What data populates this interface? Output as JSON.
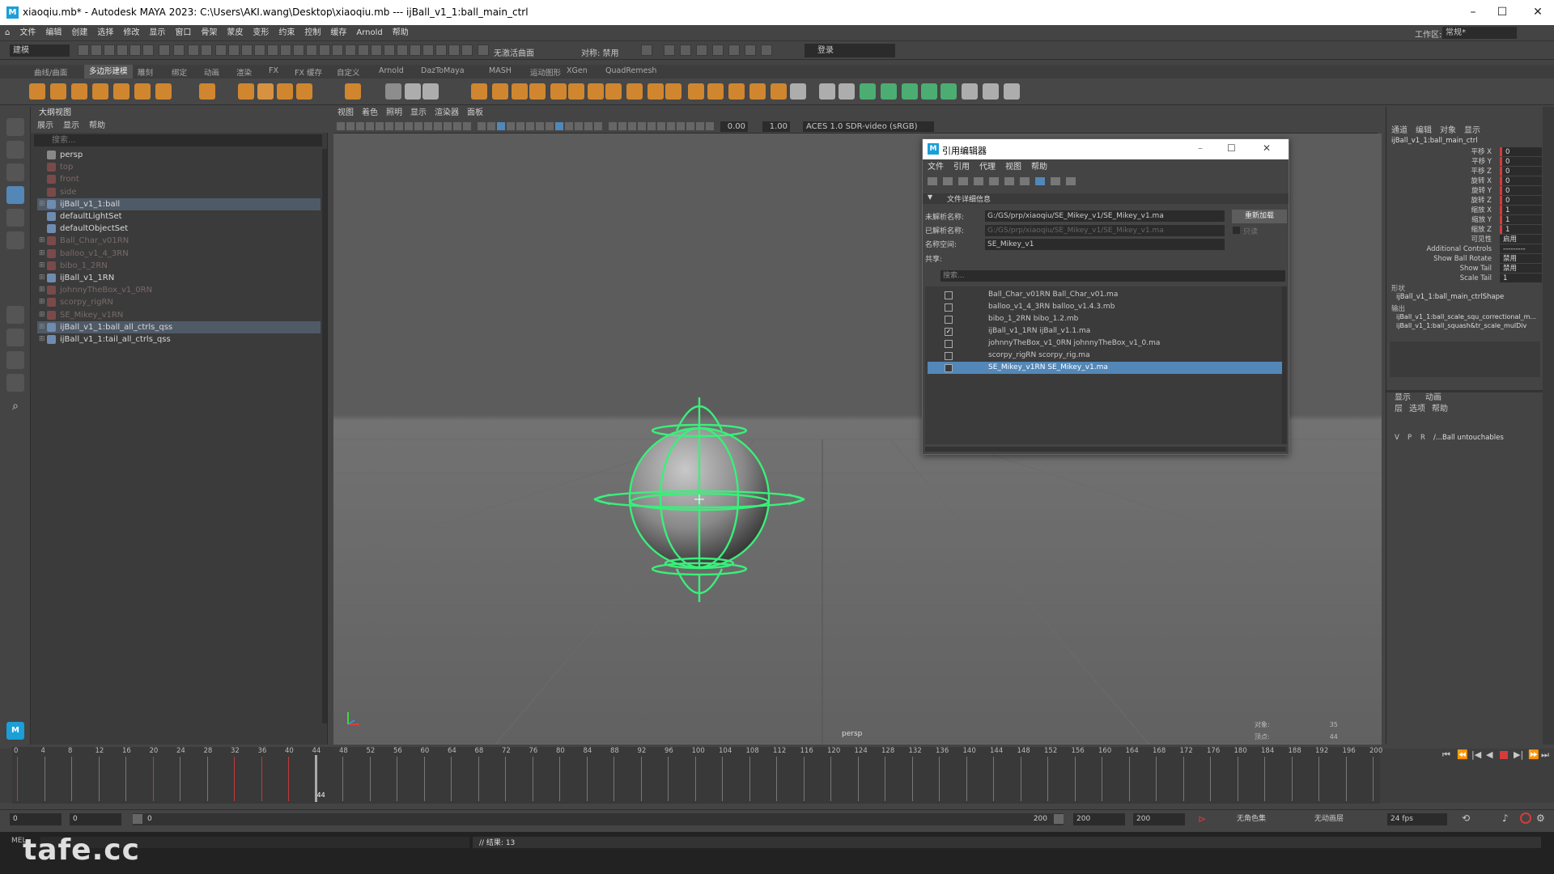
{
  "app": {
    "title": "xiaoqiu.mb* - Autodesk MAYA 2023: C:\\Users\\AKI.wang\\Desktop\\xiaoqiu.mb  ---  ijBall_v1_1:ball_main_ctrl"
  },
  "menu": [
    "文件",
    "编辑",
    "创建",
    "选择",
    "修改",
    "显示",
    "窗口",
    "骨架",
    "蒙皮",
    "变形",
    "约束",
    "控制",
    "缓存",
    "Arnold",
    "帮助"
  ],
  "workspace": {
    "label": "工作区:",
    "value": "常规*"
  },
  "status": {
    "mode": "建模",
    "live_surface": "无激活曲面",
    "symmetry": "对称: 禁用",
    "login": "登录"
  },
  "shelf_tabs": [
    "曲线/曲面",
    "多边形建模",
    "雕刻",
    "绑定",
    "动画",
    "渲染",
    "FX",
    "FX 缓存",
    "自定义",
    "Arnold",
    "DazToMaya",
    "MASH",
    "运动图形",
    "XGen",
    "QuadRemesh"
  ],
  "outliner": {
    "title": "大纲视图",
    "menu": [
      "展示",
      "显示",
      "帮助"
    ],
    "search_placeholder": "搜索...",
    "items": [
      {
        "label": "persp",
        "dim": false,
        "expand": ""
      },
      {
        "label": "top",
        "dim": true,
        "expand": ""
      },
      {
        "label": "front",
        "dim": true,
        "expand": ""
      },
      {
        "label": "side",
        "dim": true,
        "expand": ""
      },
      {
        "label": "ijBall_v1_1:ball",
        "dim": false,
        "expand": "⊞",
        "sel": true
      },
      {
        "label": "defaultLightSet",
        "dim": false,
        "expand": ""
      },
      {
        "label": "defaultObjectSet",
        "dim": false,
        "expand": ""
      },
      {
        "label": "Ball_Char_v01RN",
        "dim": true,
        "expand": "⊞"
      },
      {
        "label": "balloo_v1_4_3RN",
        "dim": true,
        "expand": "⊞"
      },
      {
        "label": "bibo_1_2RN",
        "dim": true,
        "expand": "⊞"
      },
      {
        "label": "ijBall_v1_1RN",
        "dim": false,
        "expand": "⊞"
      },
      {
        "label": "johnnyTheBox_v1_0RN",
        "dim": true,
        "expand": "⊞"
      },
      {
        "label": "scorpy_rigRN",
        "dim": true,
        "expand": "⊞"
      },
      {
        "label": "SE_Mikey_v1RN",
        "dim": true,
        "expand": "⊞"
      },
      {
        "label": "ijBall_v1_1:ball_all_ctrls_qss",
        "dim": false,
        "expand": "⊞",
        "sel": true
      },
      {
        "label": "ijBall_v1_1:tail_all_ctrls_qss",
        "dim": false,
        "expand": "⊞"
      }
    ]
  },
  "viewport": {
    "menu": [
      "视图",
      "着色",
      "照明",
      "显示",
      "渲染器",
      "面板"
    ],
    "exposure": "0.00",
    "gamma": "1.00",
    "colorspace": "ACES 1.0 SDR-video (sRGB)",
    "camera": "persp",
    "stats": [
      {
        "k": "对象:",
        "v": "35"
      },
      {
        "k": "顶点:",
        "v": "44"
      }
    ]
  },
  "ref_editor": {
    "title": "引用编辑器",
    "menu": [
      "文件",
      "引用",
      "代理",
      "视图",
      "帮助"
    ],
    "section": "文件详细信息",
    "unresolved_label": "未解析名称:",
    "unresolved_value": "G:/GS/prp/xiaoqiu/SE_Mikey_v1/SE_Mikey_v1.ma",
    "resolved_label": "已解析名称:",
    "resolved_value": "G:/GS/prp/xiaoqiu/SE_Mikey_v1/SE_Mikey_v1.ma",
    "namespace_label": "名称空间:",
    "namespace_value": "SE_Mikey_v1",
    "shared_label": "共享:",
    "reload_label": "重新加载",
    "readonly_label": "只读",
    "search_placeholder": "搜索...",
    "refs": [
      {
        "name": "Ball_Char_v01RN Ball_Char_v01.ma",
        "checked": false
      },
      {
        "name": "balloo_v1_4_3RN balloo_v1.4.3.mb",
        "checked": false
      },
      {
        "name": "bibo_1_2RN bibo_1.2.mb",
        "checked": false
      },
      {
        "name": "ijBall_v1_1RN ijBall_v1.1.ma",
        "checked": true
      },
      {
        "name": "johnnyTheBox_v1_0RN johnnyTheBox_v1_0.ma",
        "checked": false
      },
      {
        "name": "scorpy_rigRN scorpy_rig.ma",
        "checked": false
      },
      {
        "name": "SE_Mikey_v1RN SE_Mikey_v1.ma",
        "checked": false,
        "sel": true
      }
    ]
  },
  "channel_box": {
    "tabs": [
      "通道",
      "编辑",
      "对象",
      "显示"
    ],
    "node": "ijBall_v1_1:ball_main_ctrl",
    "channels": [
      {
        "name": "平移 X",
        "value": "0"
      },
      {
        "name": "平移 Y",
        "value": "0"
      },
      {
        "name": "平移 Z",
        "value": "0"
      },
      {
        "name": "旋转 X",
        "value": "0"
      },
      {
        "name": "旋转 Y",
        "value": "0"
      },
      {
        "name": "旋转 Z",
        "value": "0"
      },
      {
        "name": "缩放 X",
        "value": "1"
      },
      {
        "name": "缩放 Y",
        "value": "1"
      },
      {
        "name": "缩放 Z",
        "value": "1"
      },
      {
        "name": "可见性",
        "value": "启用"
      },
      {
        "name": "Additional Controls",
        "value": "---------"
      },
      {
        "name": "Show Ball Rotate",
        "value": "禁用"
      },
      {
        "name": "Show Tail",
        "value": "禁用"
      },
      {
        "name": "Scale Tail",
        "value": "1"
      }
    ],
    "shape_header": "形状",
    "shape": "ijBall_v1_1:ball_main_ctrlShape",
    "output_header": "输出",
    "outputs": [
      "ijBall_v1_1:ball_scale_squ_correctional_m...",
      "ijBall_v1_1:ball_squash&tr_scale_mulDiv"
    ],
    "layer_tabs": [
      "显示",
      "动画"
    ],
    "layer_menu": [
      "层",
      "选项",
      "帮助"
    ],
    "layer": {
      "v": "V",
      "p": "P",
      "r": "R",
      "name": "/...Ball untouchables"
    }
  },
  "timeline": {
    "labels": [
      "0",
      "4",
      "8",
      "12",
      "16",
      "20",
      "24",
      "28",
      "32",
      "36",
      "40",
      "44",
      "48",
      "52",
      "56",
      "60",
      "64",
      "68",
      "72",
      "76",
      "80",
      "84",
      "88",
      "92",
      "96",
      "100",
      "104",
      "108",
      "112",
      "116",
      "120",
      "124",
      "128",
      "132",
      "136",
      "140",
      "144",
      "148",
      "152",
      "156",
      "160",
      "164",
      "168",
      "172",
      "176",
      "180",
      "184",
      "188",
      "192",
      "196",
      "200"
    ],
    "current": "44",
    "keys": [
      0,
      20,
      32,
      36,
      40,
      44
    ]
  },
  "range": {
    "start": "0",
    "start2": "0",
    "slider_start": "0",
    "slider_end": "200",
    "end": "200",
    "end2": "200",
    "char_set": "无角色集",
    "anim_layer": "无动画层",
    "fps": "24 fps"
  },
  "cmd": {
    "lang": "MEL",
    "result": "// 结果: 13"
  },
  "watermark": "tafe.cc",
  "colors": {
    "accent": "#5287b8",
    "key": "#d43c3c",
    "ctrl": "#39f07a"
  }
}
